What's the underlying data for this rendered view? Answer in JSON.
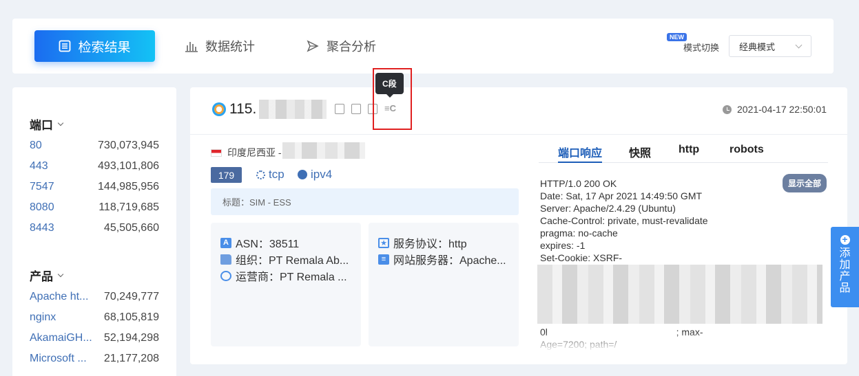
{
  "topbar": {
    "tabs": [
      "检索结果",
      "数据统计",
      "聚合分析"
    ],
    "new_badge": "NEW",
    "mode_label": "模式切换",
    "mode_value": "经典模式"
  },
  "sidebar": {
    "port_title": "端口",
    "ports": [
      {
        "k": "80",
        "v": "730,073,945"
      },
      {
        "k": "443",
        "v": "493,101,806"
      },
      {
        "k": "7547",
        "v": "144,985,956"
      },
      {
        "k": "8080",
        "v": "118,719,685"
      },
      {
        "k": "8443",
        "v": "45,505,660"
      }
    ],
    "product_title": "产品",
    "products": [
      {
        "k": "Apache ht...",
        "v": "70,249,777"
      },
      {
        "k": "nginx",
        "v": "68,105,819"
      },
      {
        "k": "AkamaiGH...",
        "v": "52,194,298"
      },
      {
        "k": "Microsoft ...",
        "v": "21,177,208"
      }
    ]
  },
  "result": {
    "ip": "115.",
    "tooltip": "C段",
    "ec_label": "≡C",
    "time": "2021-04-17 22:50:01",
    "country": "印度尼西亚 -",
    "port": "179",
    "transport": "tcp",
    "ipver": "ipv4",
    "title": "标题：SIM - ESS",
    "asn": "ASN：38511",
    "org": "组织：PT Remala Ab...",
    "isp": "运营商：PT Remala ...",
    "service": "服务协议：http",
    "server": "网站服务器：Apache..."
  },
  "response": {
    "tabs": [
      "端口响应",
      "快照",
      "http",
      "robots"
    ],
    "show_all": "显示全部",
    "lines": [
      "HTTP/1.0 200 OK",
      "Date: Sat, 17 Apr 2021 14:49:50 GMT",
      "Server: Apache/2.4.29 (Ubuntu)",
      "Cache-Control: private, must-revalidate",
      "pragma: no-cache",
      "expires: -1",
      "Set-Cookie: XSRF-",
      "",
      "",
      "",
      "",
      "",
      "0l                                                ; max-",
      "Age=7200; path=/"
    ]
  },
  "add_product": "添加产品"
}
